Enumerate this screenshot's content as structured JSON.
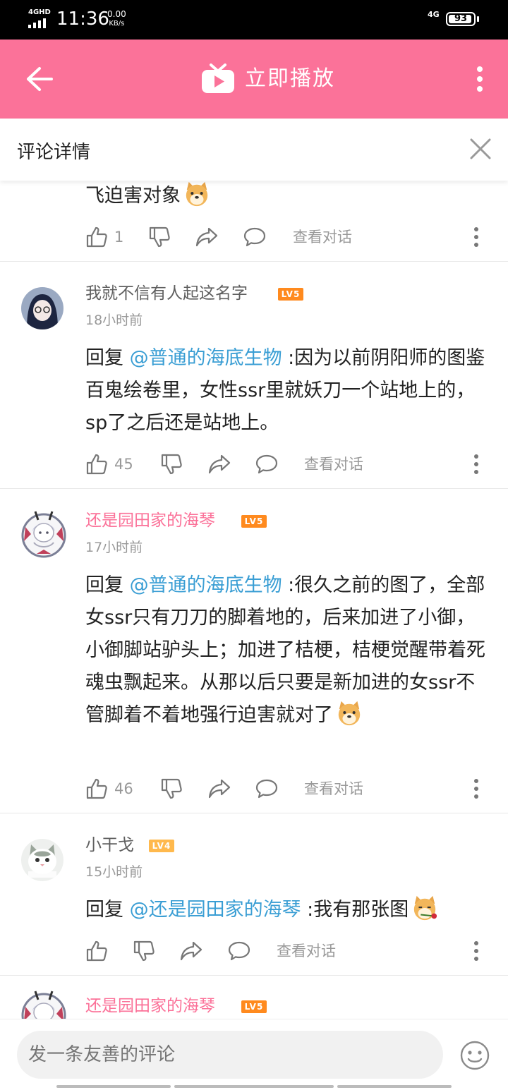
{
  "status_bar": {
    "network": "4GHD",
    "time": "11:36",
    "speed_value": "0.00",
    "speed_unit": "KB/s",
    "network_right": "4G",
    "battery": "93"
  },
  "header": {
    "title": "立即播放"
  },
  "subheader": {
    "title": "评论详情"
  },
  "comments": [
    {
      "text_tail": "飞迫害对象",
      "likes": "1",
      "view_dialog": "查看对话"
    },
    {
      "username": "我就不信有人起这名字",
      "level": "LV5",
      "time": "18小时前",
      "reply_prefix": "回复 ",
      "mention": "@普通的海底生物",
      "text": " :因为以前阴阳师的图鉴百鬼绘卷里，女性ssr里就妖刀一个站地上的，sp了之后还是站地上。",
      "likes": "45",
      "view_dialog": "查看对话"
    },
    {
      "username": "还是园田家的海琴",
      "level": "LV5",
      "time": "17小时前",
      "reply_prefix": "回复 ",
      "mention": "@普通的海底生物",
      "text": " :很久之前的图了，全部女ssr只有刀刀的脚着地的，后来加进了小御，小御脚站驴头上；加进了桔梗，桔梗觉醒带着死魂虫飘起来。从那以后只要是新加进的女ssr不管脚着不着地强行迫害就对了",
      "likes": "46",
      "view_dialog": "查看对话"
    },
    {
      "username": "小干戈",
      "level": "LV4",
      "time": "15小时前",
      "reply_prefix": "回复 ",
      "mention": "@还是园田家的海琴",
      "text": " :我有那张图",
      "view_dialog": "查看对话"
    },
    {
      "username": "还是园田家的海琴",
      "level": "LV5"
    }
  ],
  "input": {
    "placeholder": "发一条友善的评论"
  },
  "colors": {
    "brand": "#fb7299",
    "mention": "#3a9ed4",
    "level5": "#ff8a1e",
    "level4": "#ffb94d"
  }
}
